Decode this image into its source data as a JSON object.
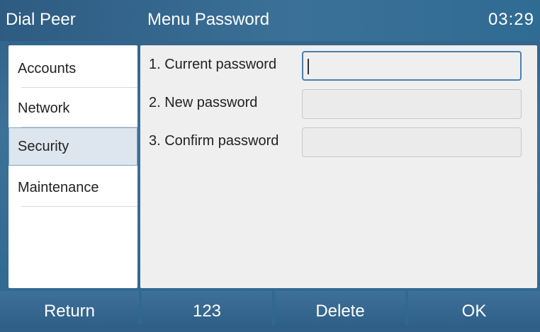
{
  "titlebar": {
    "left_title": "Dial Peer",
    "screen_title": "Menu Password",
    "clock": "03:29"
  },
  "sidebar": {
    "items": [
      {
        "label": "Accounts",
        "selected": false
      },
      {
        "label": "Network",
        "selected": false
      },
      {
        "label": "Security",
        "selected": true
      },
      {
        "label": "Maintenance",
        "selected": false
      }
    ]
  },
  "form": {
    "fields": [
      {
        "label": "1. Current password",
        "value": "",
        "focused": true
      },
      {
        "label": "2. New password",
        "value": "",
        "focused": false
      },
      {
        "label": "3. Confirm password",
        "value": "",
        "focused": false
      }
    ]
  },
  "softkeys": {
    "return_label": "Return",
    "input_mode_label": "123",
    "delete_label": "Delete",
    "ok_label": "OK"
  },
  "colors": {
    "accent": "#3b7198",
    "selected_bg": "#dde6ee",
    "focus_border": "#4a7fb0"
  }
}
